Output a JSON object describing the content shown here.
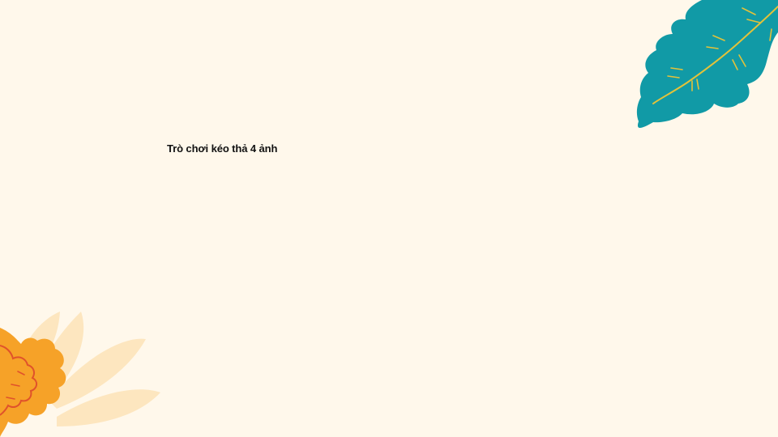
{
  "slide": {
    "title": "Trò chơi kéo thả 4 ảnh"
  },
  "decorations": {
    "top_right": "tropical-leaf-icon",
    "bottom_left": "flower-icon"
  },
  "colors": {
    "background": "#fff8eb",
    "leaf": "#119aa6",
    "leaf_light": "#2cb5b8",
    "leaf_vein": "#e3c23a",
    "flower": "#f6a228",
    "flower_outline": "#e0522b",
    "petal_light": "#fde6bf"
  }
}
